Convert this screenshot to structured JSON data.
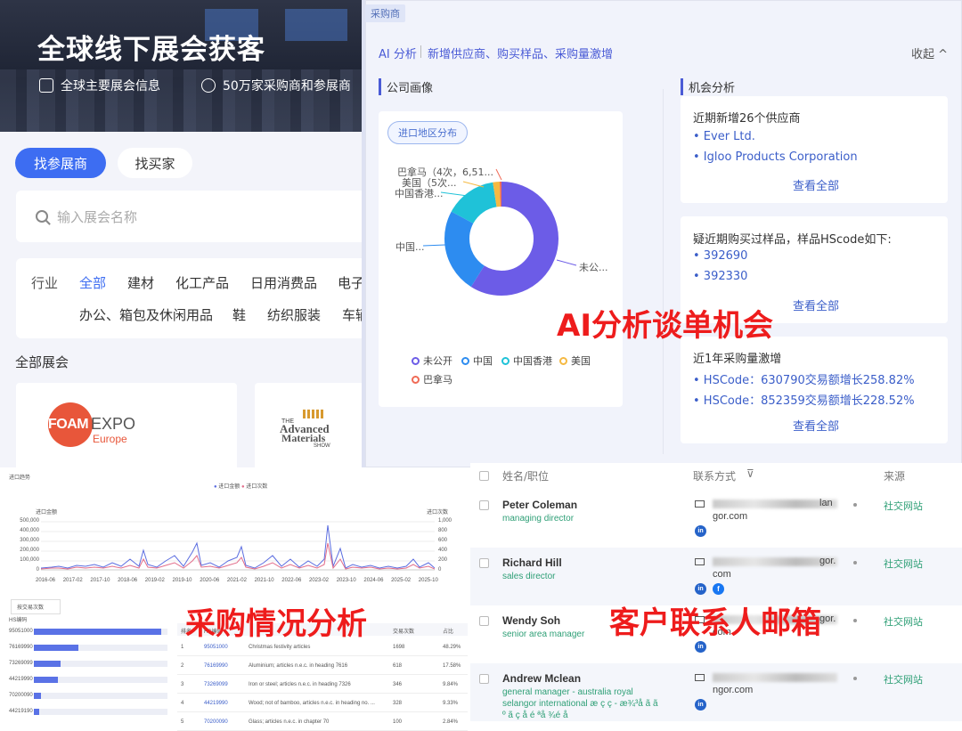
{
  "expo": {
    "hero_title": "全球线下展会获客",
    "features": [
      "全球主要展会信息",
      "50万家采购商和参展商"
    ],
    "tabs": [
      "找参展商",
      "找买家"
    ],
    "search_placeholder": "输入展会名称",
    "filter_row1": [
      "行业",
      "全部",
      "建材",
      "化工产品",
      "日用消费品",
      "电子"
    ],
    "filter_row2": [
      "办公、箱包及休闲用品",
      "鞋",
      "纺织服装",
      "车辆"
    ],
    "section_all": "全部展会",
    "cards": [
      {
        "logo_text": "FOAM",
        "logo_text2": "EXPO",
        "logo_sub": "Europe"
      },
      {
        "logo_top": "THE",
        "logo_line1": "Advanced",
        "logo_line2": "Materials",
        "logo_bottom": "SHOW"
      }
    ]
  },
  "ai": {
    "tag": "采购商",
    "brand": "AI 分析",
    "tagline": "新增供应商、购买样品、采购量激增",
    "collapse": "收起",
    "profile_title": "公司画像",
    "opportunity_title": "机会分析",
    "pill": "进口地区分布",
    "donut_labels": [
      "巴拿马（4次，6,51...",
      "美国（5次...",
      "中国香港...",
      "中国...",
      "未公..."
    ],
    "legend": [
      {
        "name": "未公开",
        "color": "#6c5ce7"
      },
      {
        "name": "中国",
        "color": "#2d8cf0"
      },
      {
        "name": "中国香港",
        "color": "#1fc2d8"
      },
      {
        "name": "美国",
        "color": "#f5b942"
      },
      {
        "name": "巴拿马",
        "color": "#f06a55"
      }
    ],
    "opps": [
      {
        "title": "近期新增26个供应商",
        "items": [
          "• Ever Ltd.",
          "• Igloo Products Corporation"
        ],
        "more": "查看全部"
      },
      {
        "title": "疑近期购买过样品，样品HScode如下:",
        "items": [
          "• 392690",
          "• 392330"
        ],
        "more": "查看全部"
      },
      {
        "title": "近1年采购量激增",
        "items": [
          "• HSCode：630790交易额增长258.82%",
          "• HSCode：852359交易额增长228.52%"
        ],
        "more": "查看全部"
      }
    ],
    "overlay": "AI分析谈单机会"
  },
  "purchase": {
    "chart_title": "进口趋势",
    "legend": [
      "进口金额",
      "进口次数"
    ],
    "left_axis_title": "进口金额",
    "right_axis_title": "进口次数",
    "left_ticks": [
      "500,000",
      "400,000",
      "300,000",
      "200,000",
      "100,000",
      "0"
    ],
    "right_ticks": [
      "1,000",
      "800",
      "600",
      "400",
      "200",
      "0"
    ],
    "x_ticks": [
      "2016-06",
      "2017-02",
      "2017-10",
      "2018-06",
      "2019-02",
      "2019-10",
      "2020-06",
      "2021-02",
      "2021-10",
      "2022-06",
      "2023-02",
      "2023-10",
      "2024-06",
      "2025-02",
      "2025-10"
    ],
    "overlay": "采购情况分析",
    "sort_select": "按交易次数",
    "hs_header": "HS编码",
    "hs_codes": [
      "95051000",
      "76169990",
      "73269099",
      "44219990",
      "70200090",
      "44219190"
    ],
    "hs_bar_fractions": [
      0.95,
      0.33,
      0.2,
      0.18,
      0.05,
      0.04
    ],
    "table_headers": [
      "排名",
      "HS编码",
      "",
      "交易次数",
      "占比"
    ],
    "table_rows": [
      {
        "rank": "1",
        "code": "95051000",
        "desc": "Christmas festivity articles",
        "count": "1698",
        "pct": "48.29%"
      },
      {
        "rank": "2",
        "code": "76169990",
        "desc": "Aluminium; articles n.e.c. in heading 7616",
        "count": "618",
        "pct": "17.58%"
      },
      {
        "rank": "3",
        "code": "73269099",
        "desc": "Iron or steel; articles n.e.c. in heading 7326",
        "count": "346",
        "pct": "9.84%"
      },
      {
        "rank": "4",
        "code": "44219990",
        "desc": "Wood; not of bamboo, articles n.e.c. in heading no. ...",
        "count": "328",
        "pct": "9.33%"
      },
      {
        "rank": "5",
        "code": "70200090",
        "desc": "Glass; articles n.e.c. in chapter 70",
        "count": "100",
        "pct": "2.84%"
      }
    ]
  },
  "contacts": {
    "headers": [
      "姓名/职位",
      "联系方式",
      "来源"
    ],
    "overlay": "客户联系人邮箱",
    "rows": [
      {
        "name": "Peter Coleman",
        "role": "managing director",
        "mail_tail": "lan",
        "mail_line2": "gor.com",
        "source": "社交网站",
        "social": [
          "in"
        ]
      },
      {
        "name": "Richard Hill",
        "role": "sales director",
        "mail_tail": "gor.",
        "mail_line2": "com",
        "source": "社交网站",
        "social": [
          "in",
          "f"
        ]
      },
      {
        "name": "Wendy Soh",
        "role": "senior area manager",
        "mail_tail": "gor.",
        "mail_line2": "com",
        "source": "社交网站",
        "social": [
          "in"
        ]
      },
      {
        "name": "Andrew Mclean",
        "role": "general manager - australia royal selangor international æ ç ç - æ¾³å ã ã º ã ç å é ªå ¾é å",
        "mail_tail": "",
        "mail_line2": "ngor.com",
        "source": "社交网站",
        "social": [
          "in"
        ]
      }
    ]
  }
}
